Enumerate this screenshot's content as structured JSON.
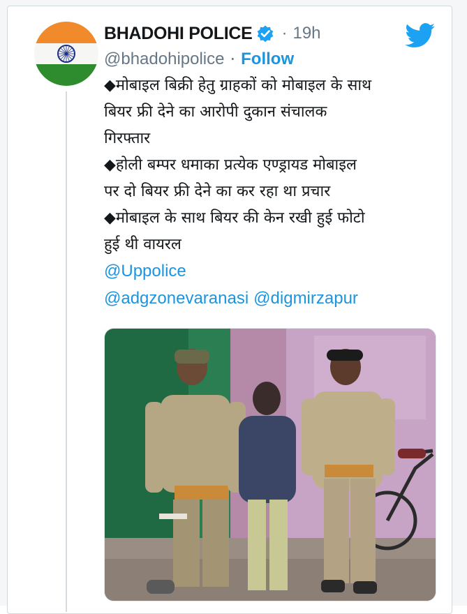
{
  "author": {
    "display_name": "BHADOHI POLICE",
    "verified": true,
    "handle": "@bhadohipolice",
    "time": "19h",
    "separator": "·",
    "follow_label": "Follow"
  },
  "brand": {
    "accent": "#1b95e0",
    "text": "#14171a",
    "secondary": "#657786"
  },
  "tweet": {
    "lines": [
      "◆मोबाइल बिक्री हेतु ग्राहकों को मोबाइल के साथ",
      "बियर फ्री देने का आरोपी दुकान संचालक",
      "गिरफ्तार",
      "◆होली बम्पर धमाका प्रत्येक एण्ड्रायड मोबाइल",
      "पर दो बियर फ्री देने का कर रहा था प्रचार",
      "◆मोबाइल के साथ बियर की केन रखी हुई फोटो",
      "हुई थी वायरल"
    ],
    "mentions": {
      "m1": "@Uppolice",
      "m2": "@adgzonevaranasi",
      "m3": "@digmirzapur"
    }
  },
  "icons": {
    "verified": "verified-badge-icon",
    "logo": "twitter-bird-icon",
    "avatar": "indian-flag-avatar"
  }
}
